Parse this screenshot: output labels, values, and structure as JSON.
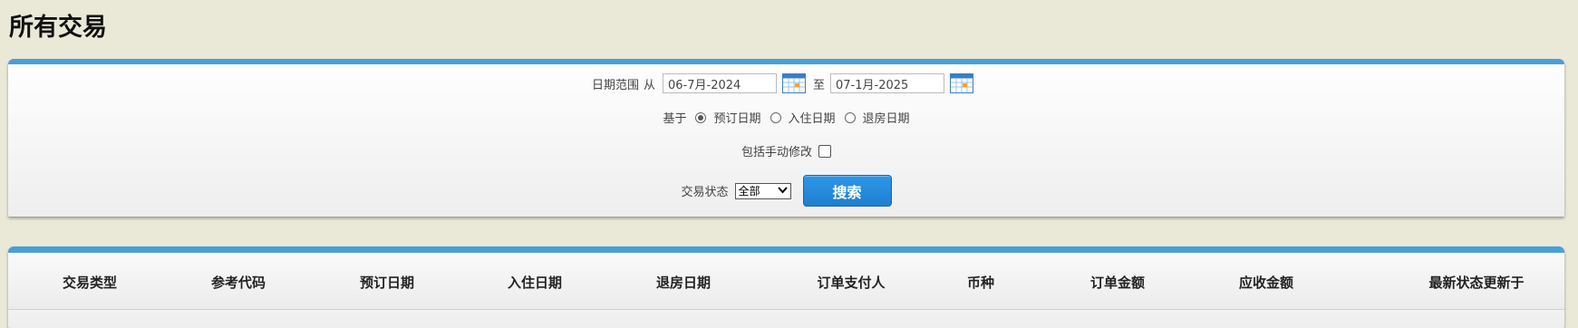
{
  "page": {
    "title": "所有交易"
  },
  "filter": {
    "date_range_label": "日期范围",
    "from_label": "从",
    "from_value": "06-7月-2024",
    "to_label": "至",
    "to_value": "07-1月-2025",
    "based_on_label": "基于",
    "based_on_options": [
      {
        "label": "预订日期",
        "checked": true
      },
      {
        "label": "入住日期",
        "checked": false
      },
      {
        "label": "退房日期",
        "checked": false
      }
    ],
    "include_manual_label": "包括手动修改",
    "include_manual_checked": false,
    "status_label": "交易状态",
    "status_selected": "全部",
    "search_label": "搜索"
  },
  "table": {
    "columns": [
      "交易类型",
      "参考代码",
      "预订日期",
      "入住日期",
      "退房日期",
      "订单支付人",
      "币种",
      "订单金额",
      "应收金额",
      "最新状态更新于"
    ]
  },
  "colors": {
    "background": "#eae9d8",
    "accent": "#4a9fd8",
    "button": "#2f97e8"
  },
  "icons": [
    "calendar-icon",
    "chevron-down-icon"
  ]
}
